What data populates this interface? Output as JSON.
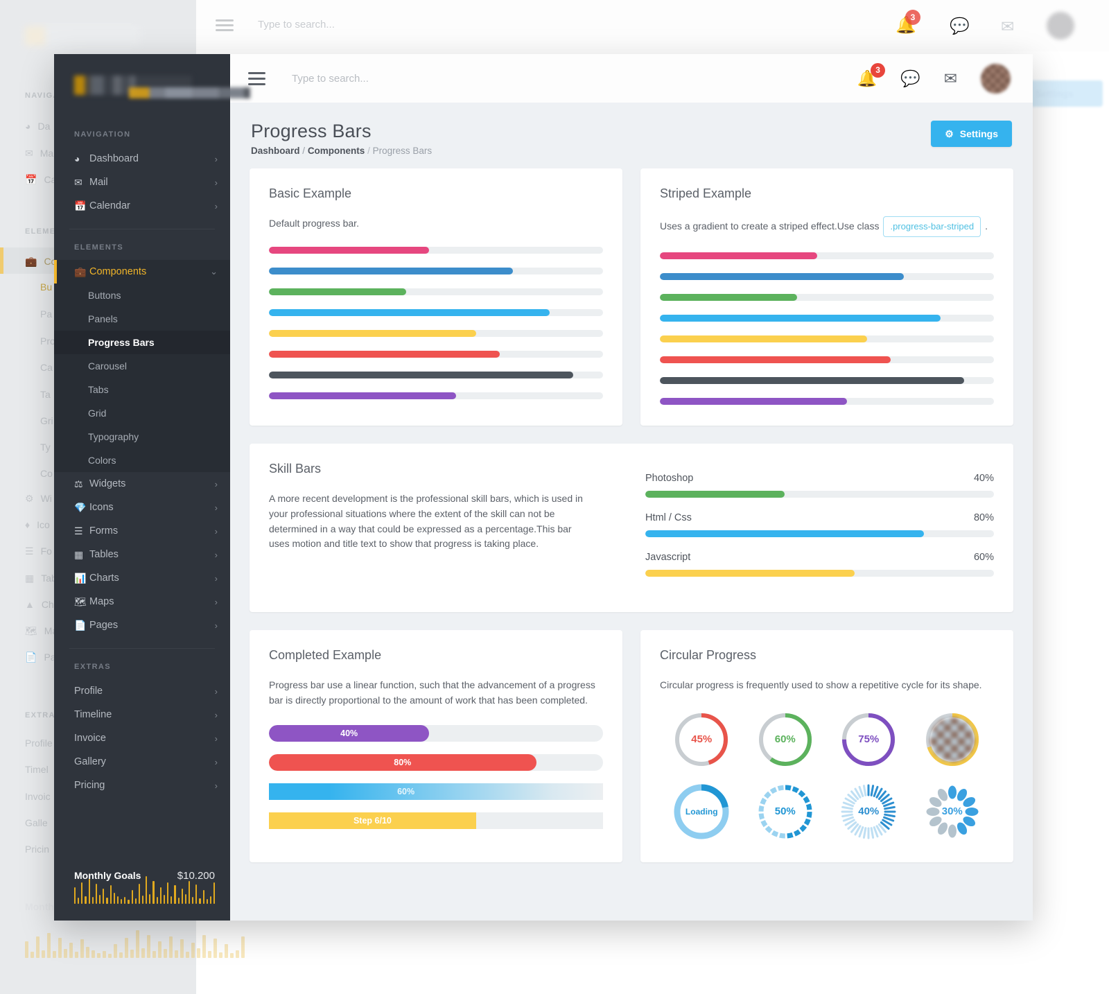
{
  "topbar": {
    "search_placeholder": "Type to search...",
    "menu_icon": "hamburger-icon",
    "bell_badge": "3",
    "icons": [
      "bell-icon",
      "chat-icon",
      "mail-icon",
      "avatar"
    ]
  },
  "sidebar": {
    "section_navigation": "NAVIGATION",
    "section_elements": "ELEMENTS",
    "section_extras": "EXTRAS",
    "nav_items": [
      {
        "label": "Dashboard",
        "icon": "dashboard-icon",
        "chevron": "›"
      },
      {
        "label": "Mail",
        "icon": "mail-icon",
        "chevron": "›"
      },
      {
        "label": "Calendar",
        "icon": "calendar-icon",
        "chevron": "›"
      }
    ],
    "components": {
      "label": "Components",
      "icon": "briefcase-icon",
      "chevron": "⌄"
    },
    "sub_items": [
      "Buttons",
      "Panels",
      "Progress Bars",
      "Carousel",
      "Tabs",
      "Grid",
      "Typography",
      "Colors"
    ],
    "current_sub": "Progress Bars",
    "element_items": [
      {
        "label": "Widgets",
        "icon": "widgets-icon",
        "chevron": "›"
      },
      {
        "label": "Icons",
        "icon": "diamond-icon",
        "chevron": "›"
      },
      {
        "label": "Forms",
        "icon": "forms-icon",
        "chevron": "›"
      },
      {
        "label": "Tables",
        "icon": "tables-icon",
        "chevron": "›"
      },
      {
        "label": "Charts",
        "icon": "charts-icon",
        "chevron": "›"
      },
      {
        "label": "Maps",
        "icon": "maps-icon",
        "chevron": "›"
      },
      {
        "label": "Pages",
        "icon": "pages-icon",
        "chevron": "›"
      }
    ],
    "extra_items": [
      {
        "label": "Profile",
        "chevron": "›"
      },
      {
        "label": "Timeline",
        "chevron": "›"
      },
      {
        "label": "Invoice",
        "chevron": "›"
      },
      {
        "label": "Gallery",
        "chevron": "›"
      },
      {
        "label": "Pricing",
        "chevron": "›"
      }
    ],
    "goals_label": "Monthly Goals",
    "goals_value": "$10.200",
    "sparkline": [
      22,
      8,
      28,
      10,
      32,
      9,
      26,
      12,
      20,
      8,
      24,
      14,
      10,
      6,
      9,
      5,
      18,
      7,
      26,
      11,
      36,
      13,
      30,
      9,
      22,
      12,
      28,
      10,
      24,
      8,
      20,
      13,
      30,
      9,
      25,
      7,
      18,
      6,
      10,
      28
    ]
  },
  "page": {
    "title": "Progress Bars",
    "breadcrumb": {
      "root": "Dashboard",
      "parent": "Components",
      "current": "Progress Bars",
      "sep": "/"
    },
    "settings_label": "Settings",
    "settings_icon": "gear-icon",
    "accent_color": "#35b3ee"
  },
  "basic_card": {
    "title": "Basic Example",
    "desc": "Default progress bar.",
    "bars": [
      {
        "name": "pink",
        "value": 48,
        "color": "#e6477f"
      },
      {
        "name": "blue",
        "value": 73,
        "color": "#3c8dcb"
      },
      {
        "name": "green",
        "value": 41,
        "color": "#5cb25d"
      },
      {
        "name": "lightblue",
        "value": 84,
        "color": "#35b3ee"
      },
      {
        "name": "yellow",
        "value": 62,
        "color": "#fbd04e"
      },
      {
        "name": "red",
        "value": 69,
        "color": "#ef5350"
      },
      {
        "name": "dark",
        "value": 91,
        "color": "#4d555d"
      },
      {
        "name": "purple",
        "value": 56,
        "color": "#8e55c4"
      }
    ]
  },
  "striped_card": {
    "title": "Striped Example",
    "desc_before": "Uses a gradient to create a striped effect.Use class",
    "code": ".progress-bar-striped",
    "desc_after": ".",
    "bars": [
      {
        "name": "pink",
        "value": 47,
        "color": "#e6477f"
      },
      {
        "name": "blue",
        "value": 73,
        "color": "#3c8dcb"
      },
      {
        "name": "green",
        "value": 41,
        "color": "#5cb25d"
      },
      {
        "name": "lightblue",
        "value": 84,
        "color": "#35b3ee"
      },
      {
        "name": "yellow",
        "value": 62,
        "color": "#fbd04e"
      },
      {
        "name": "red",
        "value": 69,
        "color": "#ef5350"
      },
      {
        "name": "dark",
        "value": 91,
        "color": "#4d555d"
      },
      {
        "name": "purple",
        "value": 56,
        "color": "#8e55c4"
      }
    ]
  },
  "skill_card": {
    "title": "Skill Bars",
    "desc": "A more recent development is the professional skill bars, which is used in your professional situations where the extent of the skill can not be determined in a way that could be expressed as a percentage.This bar uses motion and title text to show that progress is taking place.",
    "skills": [
      {
        "label": "Photoshop",
        "value": 40,
        "value_text": "40%",
        "color": "#5cb25d"
      },
      {
        "label": "Html / Css",
        "value": 80,
        "value_text": "80%",
        "color": "#35b3ee"
      },
      {
        "label": "Javascript",
        "value": 60,
        "value_text": "60%",
        "color": "#fbd04e"
      }
    ]
  },
  "completed_card": {
    "title": "Completed Example",
    "desc": "Progress bar use a linear function, such that the advancement of a progress bar is directly proportional to the amount of work that has been completed.",
    "bars": [
      {
        "name": "purple-solid",
        "value": 48,
        "label": "40%",
        "color": "#8e55c4",
        "striped": false,
        "square": false,
        "gradient": false
      },
      {
        "name": "red-striped",
        "value": 80,
        "label": "80%",
        "color": "#ef5350",
        "striped": true,
        "square": false,
        "gradient": false
      },
      {
        "name": "blue-gradient",
        "value": 100,
        "label": "60%",
        "color": "#35b3ee",
        "striped": false,
        "square": true,
        "gradient": true
      },
      {
        "name": "yellow-step",
        "value": 62,
        "label": "Step 6/10",
        "color": "#fbd04e",
        "striped": false,
        "square": true,
        "gradient": false
      }
    ]
  },
  "circular_card": {
    "title": "Circular Progress",
    "desc": "Circular progress is frequently used to show a repetitive cycle for its shape.",
    "items": [
      {
        "name": "circle-45",
        "label": "45%",
        "value": 45,
        "color": "#e8544a",
        "track": "#c8cdd1",
        "style": "ring"
      },
      {
        "name": "circle-60",
        "label": "60%",
        "value": 60,
        "color": "#5cb25d",
        "track": "#c8cdd1",
        "style": "ring"
      },
      {
        "name": "circle-75",
        "label": "75%",
        "value": 75,
        "color": "#7e4fc0",
        "track": "#c8cdd1",
        "style": "ring"
      },
      {
        "name": "circle-avatar",
        "label": "",
        "value": 70,
        "color": "#f5c842",
        "track": "#cfd4d8",
        "style": "avatar"
      },
      {
        "name": "circle-loading",
        "label": "Loading",
        "value": 22,
        "color": "#2196d4",
        "track": "#8ecdf0",
        "style": "thick"
      },
      {
        "name": "circle-50",
        "label": "50%",
        "value": 50,
        "color": "#2196d4",
        "track": "#9bd3f0",
        "style": "dashed"
      },
      {
        "name": "circle-40",
        "label": "40%",
        "value": 40,
        "color": "#2d8fd0",
        "track": "#bfdff3",
        "style": "ticks"
      },
      {
        "name": "circle-30",
        "label": "30%",
        "value": 30,
        "color": "#3aa0e0",
        "track": "#b4c3cd",
        "style": "petals"
      }
    ]
  }
}
